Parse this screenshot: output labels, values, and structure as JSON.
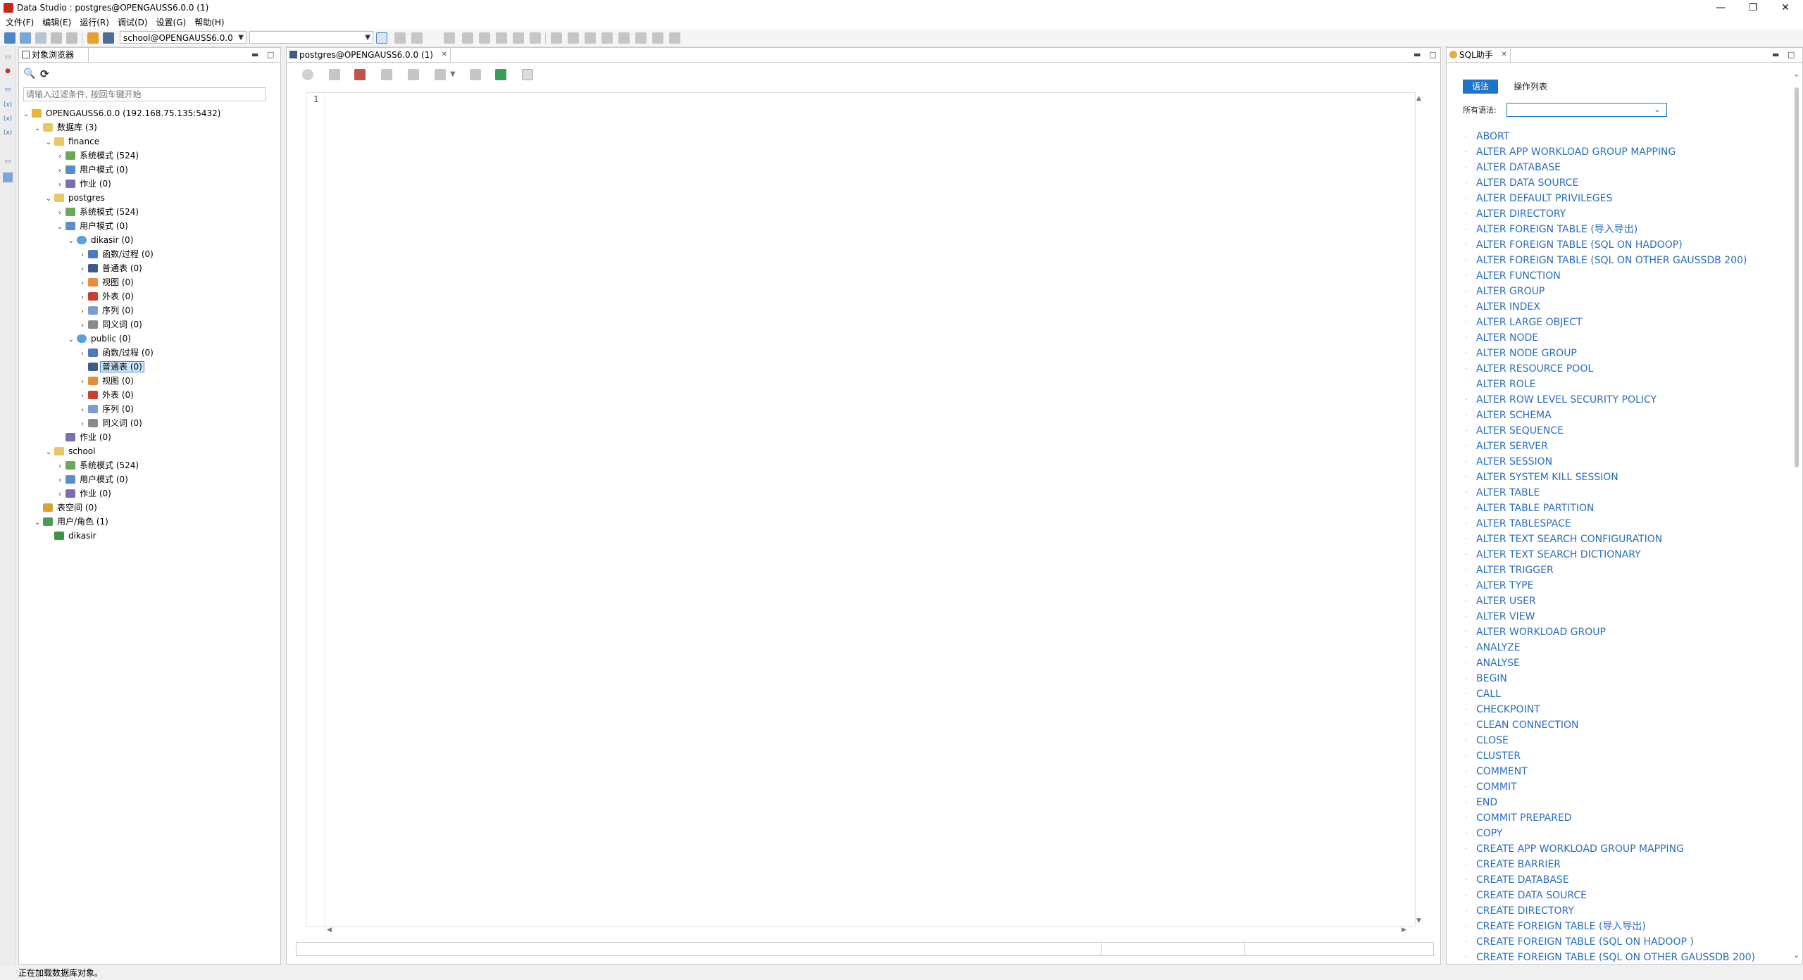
{
  "window": {
    "title": "Data Studio : postgres@OPENGAUSS6.0.0 (1)",
    "minimize_glyph": "—",
    "maximize_glyph": "❐",
    "close_glyph": "✕"
  },
  "menubar": {
    "items": [
      "文件(F)",
      "编辑(E)",
      "运行(R)",
      "调试(D)",
      "设置(G)",
      "帮助(H)"
    ]
  },
  "toolbar": {
    "connection_combo": "school@OPENGAUSS6.0.0",
    "second_combo": ""
  },
  "object_browser": {
    "tab_label": "对象浏览器",
    "filter_placeholder": "请输入过滤条件, 按回车键开始",
    "tree": [
      {
        "level": 0,
        "toggle": "v",
        "icon": "db",
        "label": "OPENGAUSS6.0.0 (192.168.75.135:5432)"
      },
      {
        "level": 1,
        "toggle": "v",
        "icon": "folder",
        "label": "数据库 (3)"
      },
      {
        "level": 2,
        "toggle": "v",
        "icon": "folder",
        "label": "finance"
      },
      {
        "level": 3,
        "toggle": ">",
        "icon": "sys",
        "label": "系统模式 (524)"
      },
      {
        "level": 3,
        "toggle": ">",
        "icon": "user",
        "label": "用户模式 (0)"
      },
      {
        "level": 3,
        "toggle": ">",
        "icon": "job",
        "label": "作业 (0)"
      },
      {
        "level": 2,
        "toggle": "v",
        "icon": "folder",
        "label": "postgres"
      },
      {
        "level": 3,
        "toggle": ">",
        "icon": "sys",
        "label": "系统模式 (524)"
      },
      {
        "level": 3,
        "toggle": "v",
        "icon": "user",
        "label": "用户模式 (0)"
      },
      {
        "level": 4,
        "toggle": "v",
        "icon": "schema",
        "label": "dikasir (0)"
      },
      {
        "level": 5,
        "toggle": ">",
        "icon": "func",
        "label": "函数/过程 (0)"
      },
      {
        "level": 5,
        "toggle": ">",
        "icon": "table",
        "label": "普通表 (0)"
      },
      {
        "level": 5,
        "toggle": ">",
        "icon": "view",
        "label": "视图 (0)"
      },
      {
        "level": 5,
        "toggle": ">",
        "icon": "ftable",
        "label": "外表 (0)"
      },
      {
        "level": 5,
        "toggle": ">",
        "icon": "seq",
        "label": "序列 (0)"
      },
      {
        "level": 5,
        "toggle": ">",
        "icon": "syn",
        "label": "同义词 (0)"
      },
      {
        "level": 4,
        "toggle": "v",
        "icon": "schema",
        "label": "public (0)"
      },
      {
        "level": 5,
        "toggle": ">",
        "icon": "func",
        "label": "函数/过程 (0)"
      },
      {
        "level": 5,
        "toggle": "",
        "icon": "table",
        "label": "普通表 (0)",
        "selected": true
      },
      {
        "level": 5,
        "toggle": ">",
        "icon": "view",
        "label": "视图 (0)"
      },
      {
        "level": 5,
        "toggle": ">",
        "icon": "ftable",
        "label": "外表 (0)"
      },
      {
        "level": 5,
        "toggle": ">",
        "icon": "seq",
        "label": "序列 (0)"
      },
      {
        "level": 5,
        "toggle": ">",
        "icon": "syn",
        "label": "同义词 (0)"
      },
      {
        "level": 3,
        "toggle": "",
        "icon": "job",
        "label": "作业 (0)"
      },
      {
        "level": 2,
        "toggle": "v",
        "icon": "folder",
        "label": "school"
      },
      {
        "level": 3,
        "toggle": ">",
        "icon": "sys",
        "label": "系统模式 (524)"
      },
      {
        "level": 3,
        "toggle": ">",
        "icon": "user",
        "label": "用户模式 (0)"
      },
      {
        "level": 3,
        "toggle": ">",
        "icon": "job",
        "label": "作业 (0)"
      },
      {
        "level": 1,
        "toggle": "",
        "icon": "ts",
        "label": "表空间 (0)"
      },
      {
        "level": 1,
        "toggle": "v",
        "icon": "roles",
        "label": "用户/角色 (1)"
      },
      {
        "level": 2,
        "toggle": "",
        "icon": "role",
        "label": "dikasir"
      }
    ]
  },
  "editor": {
    "tab_label": "postgres@OPENGAUSS6.0.0 (1)",
    "line_number": "1",
    "content": ""
  },
  "sql_helper": {
    "tab_label": "SQL助手",
    "subtabs": [
      "语法",
      "操作列表"
    ],
    "filter_label": "所有语法:",
    "filter_value": "",
    "items": [
      "ABORT",
      "ALTER APP WORKLOAD GROUP MAPPING",
      "ALTER DATABASE",
      "ALTER DATA SOURCE",
      "ALTER DEFAULT PRIVILEGES",
      "ALTER DIRECTORY",
      "ALTER FOREIGN TABLE (导入导出)",
      "ALTER FOREIGN TABLE (SQL ON HADOOP)",
      "ALTER FOREIGN TABLE (SQL ON OTHER GAUSSDB 200)",
      "ALTER FUNCTION",
      "ALTER GROUP",
      "ALTER INDEX",
      "ALTER LARGE OBJECT",
      "ALTER NODE",
      "ALTER NODE GROUP",
      "ALTER RESOURCE POOL",
      "ALTER ROLE",
      "ALTER ROW LEVEL SECURITY POLICY",
      "ALTER SCHEMA",
      "ALTER SEQUENCE",
      "ALTER SERVER",
      "ALTER SESSION",
      "ALTER SYSTEM KILL SESSION",
      "ALTER TABLE",
      "ALTER TABLE PARTITION",
      "ALTER TABLESPACE",
      "ALTER TEXT SEARCH CONFIGURATION",
      "ALTER TEXT SEARCH DICTIONARY",
      "ALTER TRIGGER",
      "ALTER TYPE",
      "ALTER USER",
      "ALTER VIEW",
      "ALTER WORKLOAD GROUP",
      "ANALYZE",
      "ANALYSE",
      "BEGIN",
      "CALL",
      "CHECKPOINT",
      "CLEAN CONNECTION",
      "CLOSE",
      "CLUSTER",
      "COMMENT",
      "COMMIT",
      "END",
      "COMMIT PREPARED",
      "COPY",
      "CREATE APP WORKLOAD GROUP MAPPING",
      "CREATE BARRIER",
      "CREATE DATABASE",
      "CREATE DATA SOURCE",
      "CREATE DIRECTORY",
      "CREATE FOREIGN TABLE (导入导出)",
      "CREATE FOREIGN TABLE (SQL ON HADOOP )",
      "CREATE FOREIGN TABLE (SQL ON OTHER GAUSSDB 200)"
    ]
  },
  "status": {
    "text": "正在加载数据库对象。"
  },
  "colors": {
    "accent": "#1e74c8",
    "link": "#2a6ebb",
    "selection": "#cde8ff"
  }
}
